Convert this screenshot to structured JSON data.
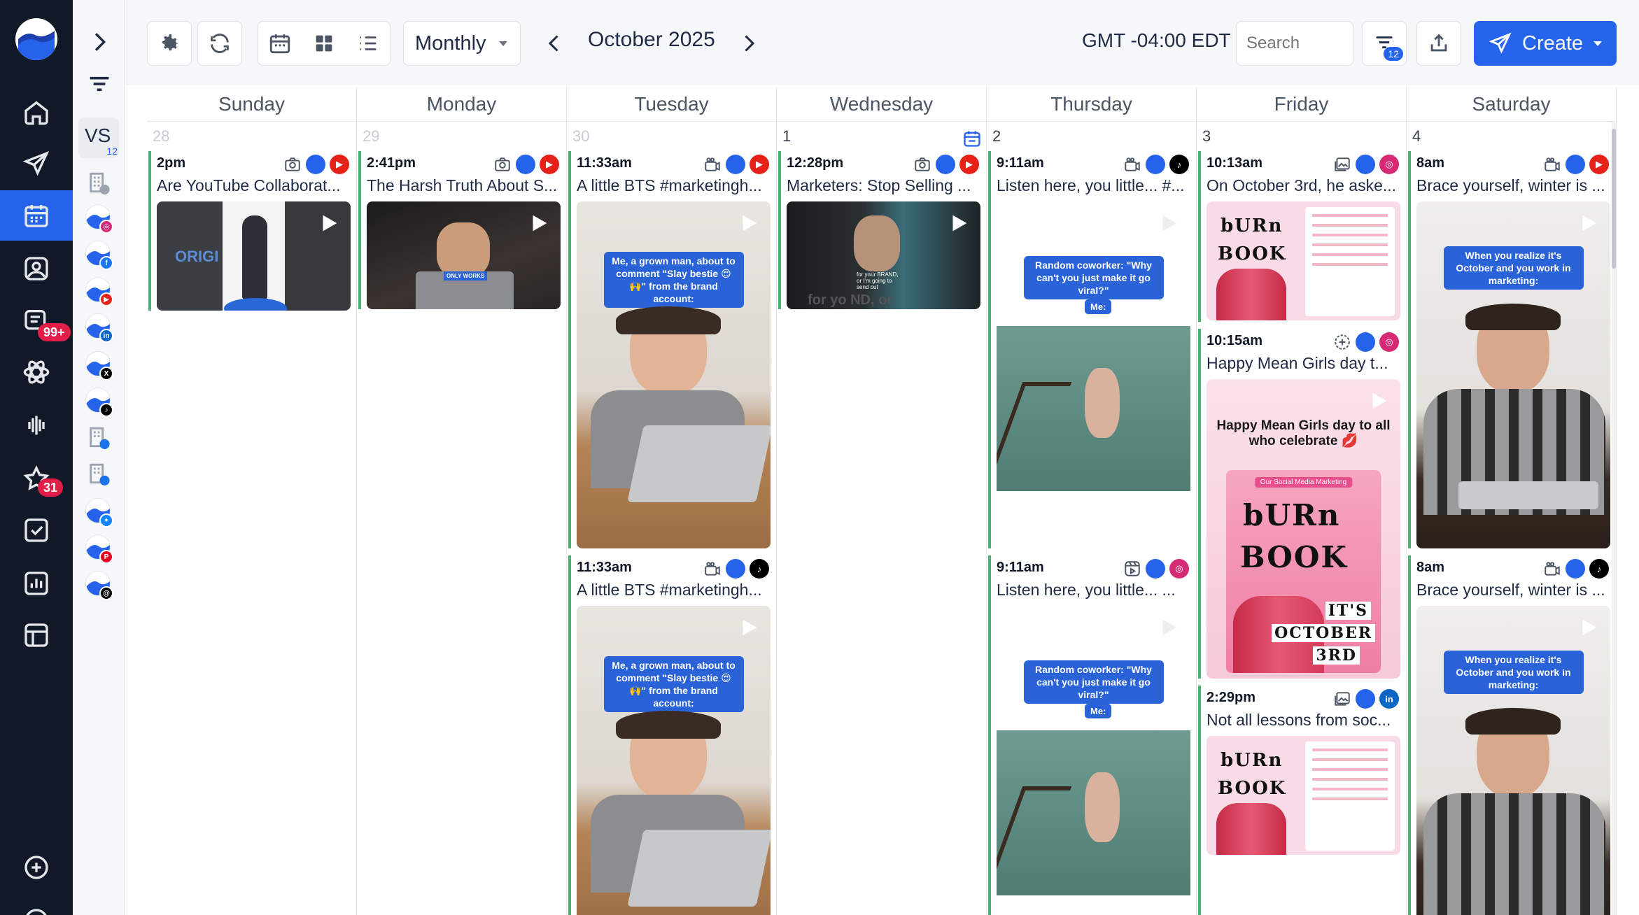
{
  "nav": {
    "badges": {
      "inbox": "99+",
      "reviews": "31"
    }
  },
  "sub": {
    "initials": "VS",
    "count": "12"
  },
  "toolbar": {
    "view_select": "Monthly",
    "month_label": "October 2025",
    "timezone": "GMT -04:00 EDT",
    "search_placeholder": "Search",
    "filter_count": "12",
    "create_label": "Create"
  },
  "calendar": {
    "days": [
      "Sunday",
      "Monday",
      "Tuesday",
      "Wednesday",
      "Thursday",
      "Friday",
      "Saturday"
    ],
    "dates": [
      "28",
      "29",
      "30",
      "1",
      "2",
      "3",
      "4"
    ],
    "posts": {
      "sun1": {
        "time": "2pm",
        "caption": "Are YouTube Collaborat...",
        "thumb_text": "ORIGI"
      },
      "mon1": {
        "time": "2:41pm",
        "caption": "The Harsh Truth About S...",
        "thumb_text": "ONLY WORKS"
      },
      "tue1": {
        "time": "11:33am",
        "caption": "A little BTS #marketingh...",
        "overlay": "Me, a grown man, about to comment \"Slay bestie 😍🙌\" from the brand account:"
      },
      "tue2": {
        "time": "11:33am",
        "caption": "A little BTS #marketingh...",
        "overlay": "Me, a grown man, about to comment \"Slay bestie 😍🙌\" from the brand account:"
      },
      "wed1": {
        "time": "12:28pm",
        "caption": "Marketers: Stop Selling ...",
        "thumb_text": "for your BRAND, or I'm going to send out",
        "thumb_text2": "for yo      ND, or"
      },
      "thu1": {
        "time": "9:11am",
        "caption": "Listen here, you little... #...",
        "overlay": "Random coworker: \"Why can't you just make it go viral?\"",
        "me": "Me:"
      },
      "thu2": {
        "time": "9:11am",
        "caption": "Listen here, you little...        ...",
        "overlay": "Random coworker: \"Why can't you just make it go viral?\"",
        "me": "Me:"
      },
      "fri1": {
        "time": "10:13am",
        "caption": "On October 3rd, he aske..."
      },
      "fri2": {
        "time": "10:15am",
        "caption": "Happy Mean Girls day t...",
        "heading": "Happy Mean Girls day to all who celebrate 💋",
        "tag": "Our Social Media Marketing",
        "burn": "bURn",
        "book": "BOOK",
        "oct1": "IT'S",
        "oct2": "OCTOBER",
        "oct3": "3RD"
      },
      "fri3": {
        "time": "2:29pm",
        "caption": "Not all lessons from soc..."
      },
      "sat1": {
        "time": "8am",
        "caption": "Brace yourself, winter is ...",
        "overlay": "When you realize it's October and you work in marketing:"
      },
      "sat2": {
        "time": "8am",
        "caption": "Brace yourself, winter is ...",
        "overlay": "When you realize it's October and you work in marketing:"
      }
    },
    "burn_small": {
      "burn": "bURn",
      "book": "BOOK"
    }
  },
  "colors": {
    "accent": "#2563eb",
    "nav_bg": "#111827",
    "post_border": "#4caf73",
    "youtube": "#e62117",
    "badge": "#e11d48"
  }
}
